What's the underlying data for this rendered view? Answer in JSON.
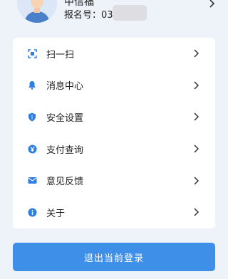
{
  "profile": {
    "name": "中信福",
    "reg_label": "报名号：03"
  },
  "menu": [
    {
      "id": "scan",
      "label": "扫一扫",
      "icon": "scan-icon"
    },
    {
      "id": "messages",
      "label": "消息中心",
      "icon": "bell-icon"
    },
    {
      "id": "security",
      "label": "安全设置",
      "icon": "shield-icon"
    },
    {
      "id": "payment",
      "label": "支付查询",
      "icon": "yen-icon"
    },
    {
      "id": "feedback",
      "label": "意见反馈",
      "icon": "mail-icon"
    },
    {
      "id": "about",
      "label": "关于",
      "icon": "info-icon"
    }
  ],
  "logout": {
    "label": "退出当前登录"
  },
  "colors": {
    "accent": "#3d8fe8",
    "icon": "#2f7fe0",
    "background": "#eef2f9"
  }
}
